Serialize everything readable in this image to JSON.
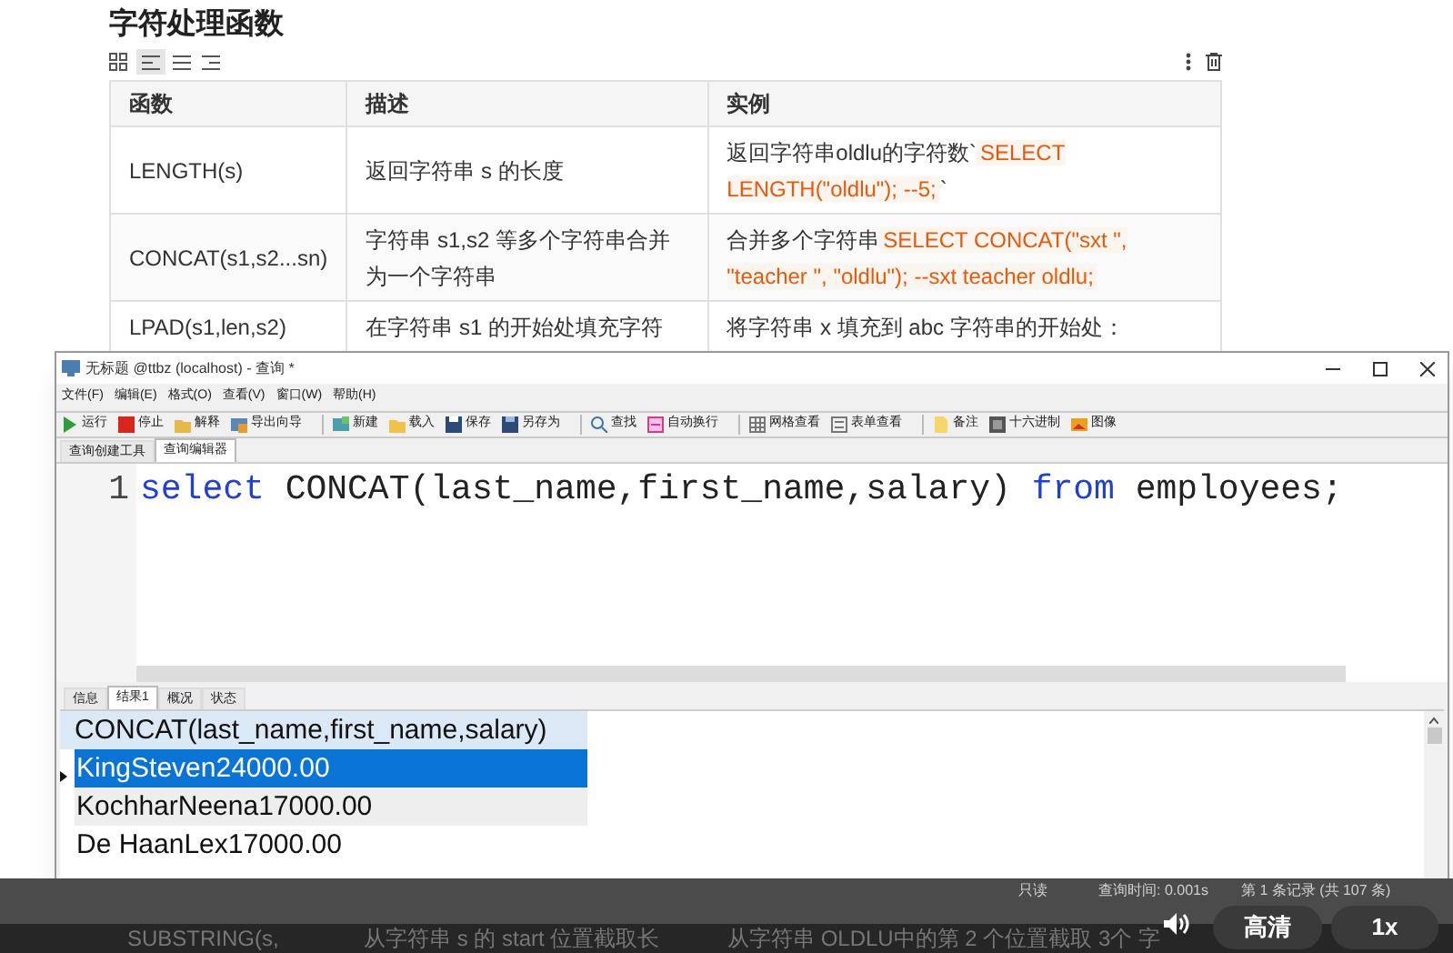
{
  "page": {
    "heading": "字符处理函数",
    "table": {
      "columns": [
        "函数",
        "描述",
        "实例"
      ],
      "rows": [
        {
          "function": "LENGTH(s)",
          "description": "返回字符串 s 的长度",
          "example": [
            {
              "kind": "text",
              "text": "返回字符串oldlu的字符数`"
            },
            {
              "kind": "code",
              "text": "SELECT LENGTH(\"oldlu\"); --5;"
            },
            {
              "kind": "text",
              "text": "`"
            }
          ]
        },
        {
          "function": "CONCAT(s1,s2...sn)",
          "description": "字符串 s1,s2 等多个字符串合并为一个字符串",
          "example": [
            {
              "kind": "text",
              "text": "合并多个字符串"
            },
            {
              "kind": "code",
              "text": "SELECT CONCAT(\"sxt \", \"teacher \", \"oldlu\"); --sxt teacher oldlu;"
            }
          ]
        },
        {
          "function": "LPAD(s1,len,s2)",
          "description": "在字符串 s1 的开始处填充字符",
          "example": [
            {
              "kind": "text",
              "text": "将字符串 x 填充到 abc 字符串的开始处："
            }
          ]
        }
      ]
    }
  },
  "window": {
    "title": "无标题 @ttbz (localhost) - 查询 *",
    "menu": [
      "文件(F)",
      "编辑(E)",
      "格式(O)",
      "查看(V)",
      "窗口(W)",
      "帮助(H)"
    ],
    "toolbar_groups": [
      [
        "运行",
        "停止",
        "解释",
        "导出向导"
      ],
      [
        "新建",
        "载入",
        "保存",
        "另存为"
      ],
      [
        "查找",
        "自动换行"
      ],
      [
        "网格查看",
        "表单查看"
      ],
      [
        "备注",
        "十六进制",
        "图像"
      ]
    ],
    "tabs": [
      {
        "label": "查询创建工具",
        "selected": false
      },
      {
        "label": "查询编辑器",
        "selected": true
      }
    ],
    "editor": {
      "line_number": "1",
      "tokens": [
        {
          "kind": "keyword",
          "text": "select"
        },
        {
          "kind": "plain",
          "text": "CONCAT(last_name,first_name,salary)"
        },
        {
          "kind": "keyword",
          "text": "from"
        },
        {
          "kind": "plain",
          "text": "employees;"
        }
      ]
    },
    "result_tabs": [
      {
        "label": "信息",
        "selected": false
      },
      {
        "label": "结果1",
        "selected": true
      },
      {
        "label": "概况",
        "selected": false
      },
      {
        "label": "状态",
        "selected": false
      }
    ],
    "grid": {
      "column": "CONCAT(last_name,first_name,salary)",
      "rows": [
        {
          "value": "KingSteven24000.00",
          "selected": true
        },
        {
          "value": "KochharNeena17000.00",
          "selected": false
        },
        {
          "value": "De HaanLex17000.00",
          "selected": false
        }
      ]
    },
    "status_bar": [
      "只读",
      "查询时间: 0.001s",
      "第 1 条记录 (共 107 条)"
    ]
  },
  "hidden_row": [
    "SUBSTRING(s,",
    "从字符串 s 的 start 位置截取长",
    "从字符串 OLDLU中的第 2 个位置截取 3个 字"
  ],
  "player": {
    "quality": "高清",
    "speed": "1x"
  }
}
